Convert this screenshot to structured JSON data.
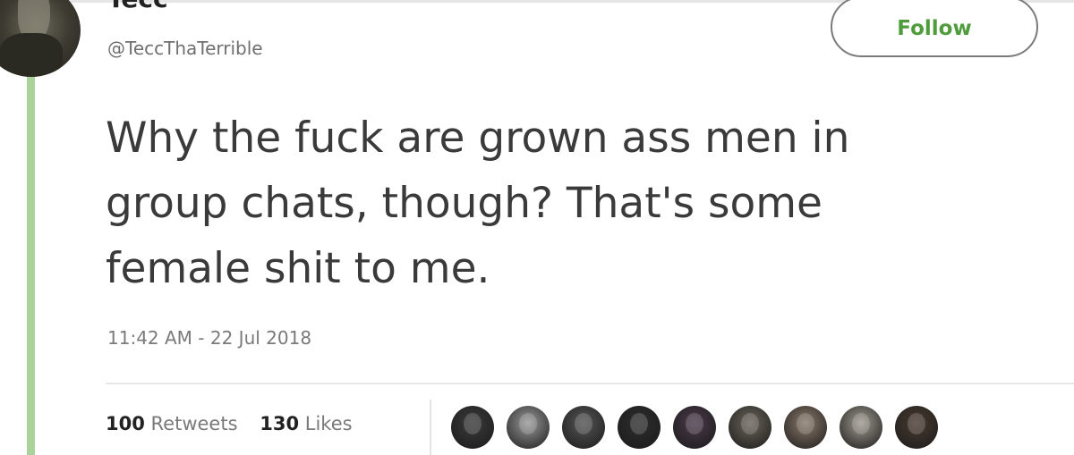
{
  "tweet": {
    "display_name": "Tecc",
    "handle": "@TeccThaTerrible",
    "follow_label": "Follow",
    "text": "Why the fuck are grown ass men in\ngroup chats, though?  That's some\nfemale shit to me.",
    "timestamp": "11:42 AM - 22 Jul 2018",
    "retweets_count": "100",
    "retweets_label": "Retweets",
    "likes_count": "130",
    "likes_label": "Likes"
  },
  "colors": {
    "follow_text": "#4f9c3c",
    "thread_bar": "#a9d39a"
  },
  "likers": [
    {
      "avatar_color": "#3b3b3b"
    },
    {
      "avatar_color": "#9a9a9a"
    },
    {
      "avatar_color": "#555555"
    },
    {
      "avatar_color": "#2e2e2e"
    },
    {
      "avatar_color": "#4a3a4a"
    },
    {
      "avatar_color": "#6b655a"
    },
    {
      "avatar_color": "#8a7a6a"
    },
    {
      "avatar_color": "#a09a90"
    },
    {
      "avatar_color": "#4a3b30"
    }
  ]
}
